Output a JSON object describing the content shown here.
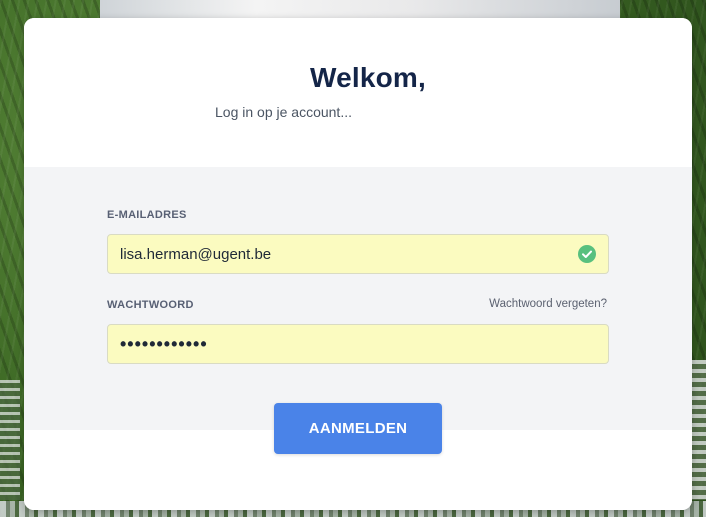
{
  "login": {
    "title": "Welkom,",
    "subtitle": "Log in op je account...",
    "email_label": "E-MAILADRES",
    "email_value": "lisa.herman@ugent.be",
    "email_status_icon": "check-circle-icon",
    "password_label": "WACHTWOORD",
    "forgot_password_label": "Wachtwoord vergeten?",
    "password_value": "••••••••••••",
    "submit_label": "AANMELDEN"
  },
  "colors": {
    "title": "#142548",
    "accent_button": "#4a83e8",
    "input_autofill_bg": "#fbfbc0",
    "valid_icon": "#58c07e",
    "body_panel_bg": "#f3f4f6"
  }
}
